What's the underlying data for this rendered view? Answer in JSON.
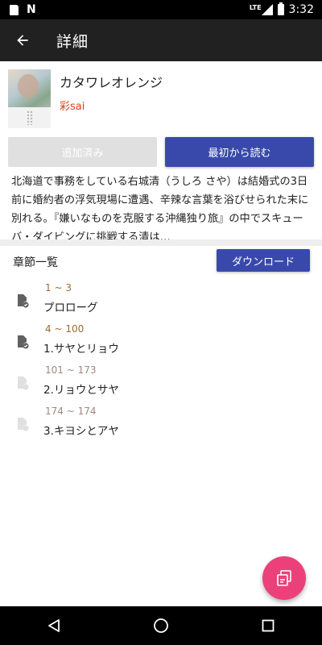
{
  "status_bar": {
    "time": "3:32",
    "network": "LTE",
    "icons": [
      "sd-card-icon",
      "n-notification-icon",
      "lte-signal-icon",
      "battery-icon"
    ]
  },
  "app_bar": {
    "title": "詳細",
    "back_icon": "arrow-back-icon"
  },
  "book": {
    "title": "カタワレオレンジ",
    "author": "彩sai"
  },
  "actions": {
    "added_label": "追加済み",
    "read_label": "最初から読む"
  },
  "synopsis": "北海道で事務をしている右城清（うしろ さや）は結婚式の3日前に婚約者の浮気現場に遭遇、辛辣な言葉を浴びせられた末に別れる。『嫌いなものを克服する沖縄独り旅』の中でスキューバ・ダイビングに挑戦する清は…",
  "chapters": {
    "label": "章節一覧",
    "download_label": "ダウンロード",
    "items": [
      {
        "range": "1 ~ 3",
        "name": "プロローグ",
        "downloaded": true
      },
      {
        "range": "4 ~ 100",
        "name": "1.サヤとリョウ",
        "downloaded": true
      },
      {
        "range": "101 ~ 173",
        "name": "2.リョウとサヤ",
        "downloaded": false
      },
      {
        "range": "174 ~ 174",
        "name": "3.キヨシとアヤ",
        "downloaded": false
      }
    ]
  },
  "fab": {
    "icon": "swap-reading-icon"
  },
  "nav_bar": {
    "icons": [
      "nav-back-icon",
      "nav-home-icon",
      "nav-recents-icon"
    ]
  },
  "colors": {
    "app_bar": "#212121",
    "primary_button": "#3949ab",
    "disabled_button": "#e0e0e0",
    "author": "#d84315",
    "fab": "#ec407a"
  }
}
